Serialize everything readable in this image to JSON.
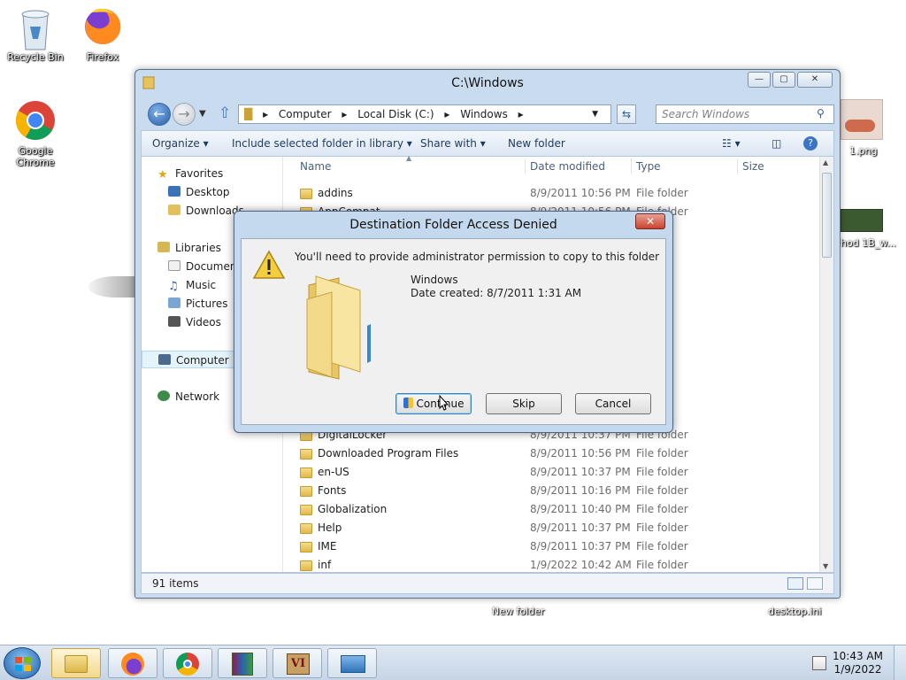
{
  "desktop": {
    "icons": [
      {
        "label": "Recycle Bin"
      },
      {
        "label": "Firefox"
      },
      {
        "label": "Google Chrome"
      }
    ],
    "partial_labels": {
      "right_png": "1.png",
      "right_video": "hod 1B_w...",
      "new_folder": "New folder",
      "desktop_ini": "desktop.ini"
    }
  },
  "explorer": {
    "title": "C:\\Windows",
    "window_buttons": {
      "minimize": "—",
      "maximize": "▢",
      "close": "✕"
    },
    "breadcrumb": [
      "Computer",
      "Local Disk (C:)",
      "Windows"
    ],
    "search_placeholder": "Search Windows",
    "toolbar": {
      "organize": "Organize",
      "include": "Include selected folder in library",
      "share": "Share with",
      "new_folder": "New folder"
    },
    "nav": {
      "favorites": "Favorites",
      "desktop": "Desktop",
      "downloads": "Downloads",
      "libraries": "Libraries",
      "documents": "Documents",
      "music": "Music",
      "pictures": "Pictures",
      "videos": "Videos",
      "computer": "Computer",
      "network": "Network"
    },
    "columns": {
      "name": "Name",
      "date": "Date modified",
      "type": "Type",
      "size": "Size"
    },
    "files": [
      {
        "name": "addins",
        "date": "8/9/2011 10:56 PM",
        "type": "File folder"
      },
      {
        "name": "AppCompat",
        "date": "8/9/2011 10:56 PM",
        "type": "File folder"
      },
      {
        "name": "DigitalLocker",
        "date": "8/9/2011 10:37 PM",
        "type": "File folder"
      },
      {
        "name": "Downloaded Program Files",
        "date": "8/9/2011 10:56 PM",
        "type": "File folder"
      },
      {
        "name": "en-US",
        "date": "8/9/2011 10:37 PM",
        "type": "File folder"
      },
      {
        "name": "Fonts",
        "date": "8/9/2011 10:16 PM",
        "type": "File folder"
      },
      {
        "name": "Globalization",
        "date": "8/9/2011 10:40 PM",
        "type": "File folder"
      },
      {
        "name": "Help",
        "date": "8/9/2011 10:37 PM",
        "type": "File folder"
      },
      {
        "name": "IME",
        "date": "8/9/2011 10:37 PM",
        "type": "File folder"
      },
      {
        "name": "inf",
        "date": "1/9/2022 10:42 AM",
        "type": "File folder"
      }
    ],
    "status": "91 items"
  },
  "dialog": {
    "title": "Destination Folder Access Denied",
    "close": "✕",
    "message": "You'll need to provide administrator permission to copy to this folder",
    "folder_name": "Windows",
    "date_created": "Date created: 8/7/2011 1:31 AM",
    "buttons": {
      "continue": "Continue",
      "skip": "Skip",
      "cancel": "Cancel"
    }
  },
  "taskbar": {
    "time": "10:43 AM",
    "date": "1/9/2022"
  }
}
